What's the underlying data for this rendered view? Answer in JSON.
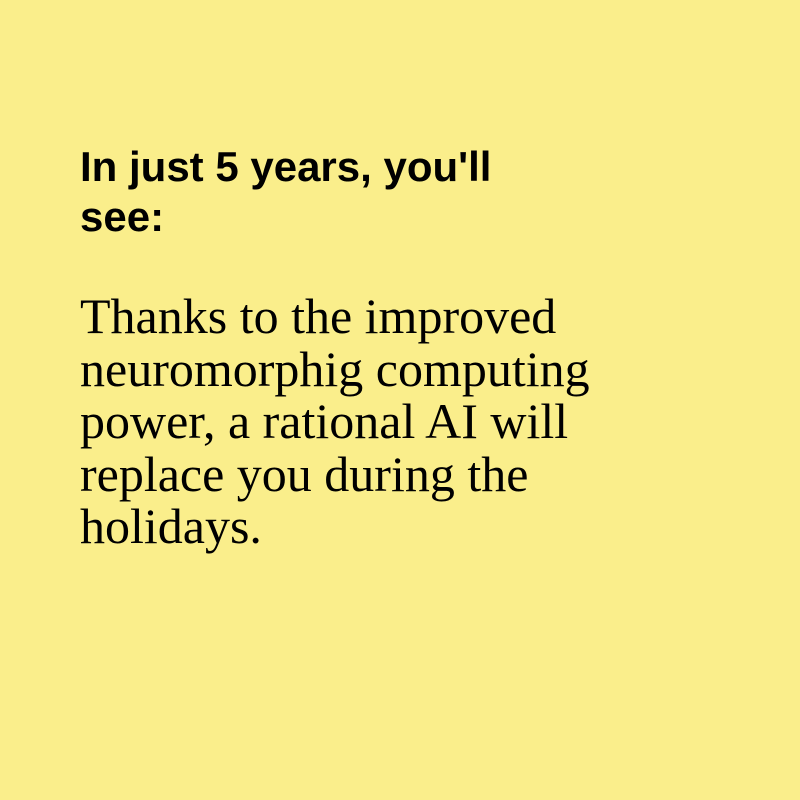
{
  "headline": {
    "lines": [
      "In just 5 years, you'll",
      "see:"
    ]
  },
  "body": {
    "lines": [
      "Thanks to the improved",
      "neuromorphig computing",
      "power, a rational AI will",
      "replace you during the",
      "holidays."
    ]
  },
  "colors": {
    "background": "#FAEE8B",
    "text": "#000000"
  }
}
